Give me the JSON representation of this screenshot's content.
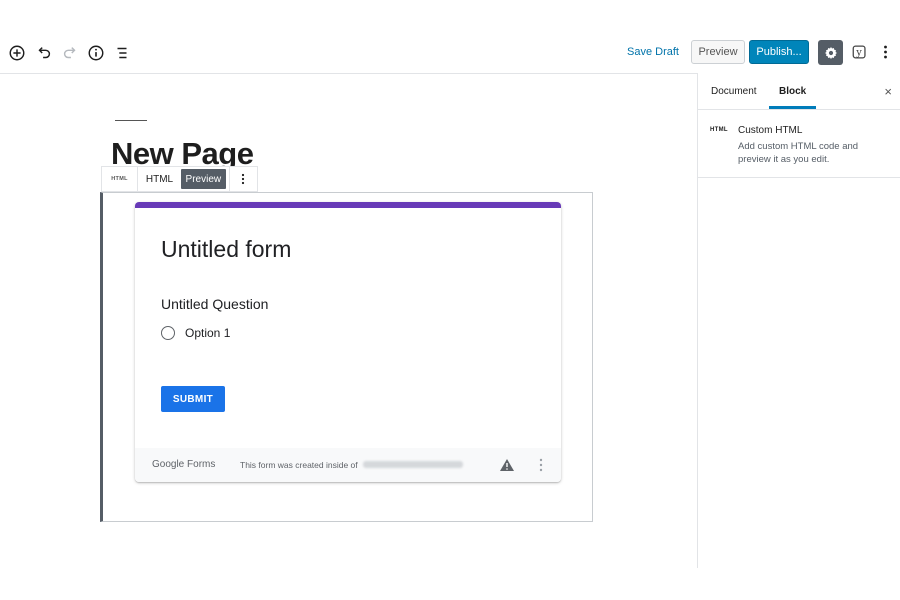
{
  "toolbar": {
    "save_draft_label": "Save Draft",
    "preview_label": "Preview",
    "publish_label": "Publish...",
    "yoast_label": "y"
  },
  "sidebar": {
    "tabs": [
      {
        "label": "Document",
        "active": false
      },
      {
        "label": "Block",
        "active": true
      }
    ],
    "close_label": "×",
    "block": {
      "icon_label": "HTML",
      "title": "Custom HTML",
      "description": "Add custom HTML code and preview it as you edit."
    }
  },
  "editor": {
    "page_title": "New Page",
    "block_toolbar": {
      "icon_label": "HTML",
      "html_tab": "HTML",
      "preview_tab": "Preview"
    }
  },
  "form": {
    "accent_color": "#673ab7",
    "title": "Untitled form",
    "question": "Untitled Question",
    "option_label": "Option 1",
    "submit_label": "SUBMIT",
    "footer": {
      "logo_text": "Google Forms",
      "note": "This form was created inside of"
    }
  },
  "colors": {
    "publish": "#0085ba",
    "link": "#0073aa",
    "submit": "#1a73e8"
  }
}
